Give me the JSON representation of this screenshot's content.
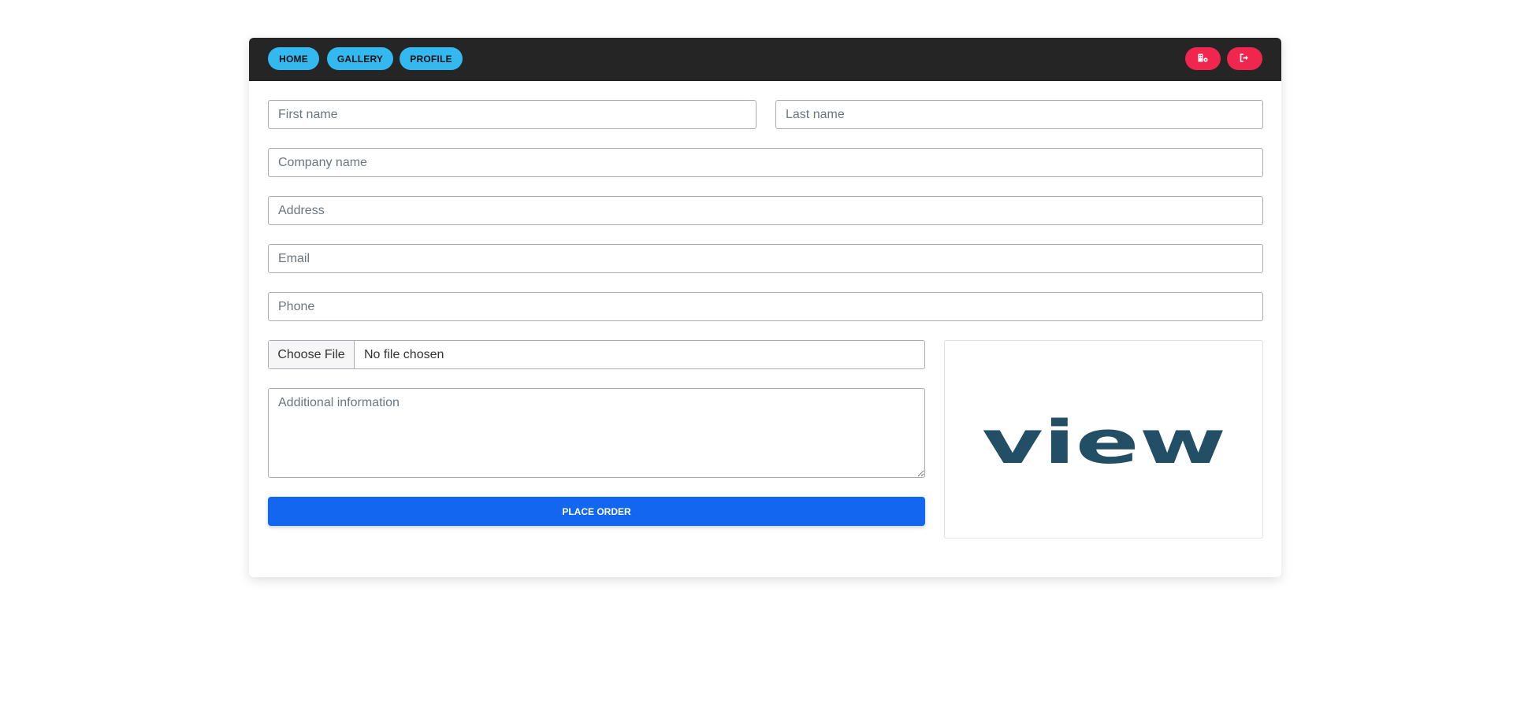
{
  "nav": {
    "home_label": "HOME",
    "gallery_label": "GALLERY",
    "profile_label": "PROFILE",
    "icons": [
      "building-icon",
      "sign-out-icon"
    ]
  },
  "form": {
    "first_name": {
      "placeholder": "First name",
      "value": ""
    },
    "last_name": {
      "placeholder": "Last name",
      "value": ""
    },
    "company_name": {
      "placeholder": "Company name",
      "value": ""
    },
    "address": {
      "placeholder": "Address",
      "value": ""
    },
    "email": {
      "placeholder": "Email",
      "value": ""
    },
    "phone": {
      "placeholder": "Phone",
      "value": ""
    },
    "file": {
      "button_label": "Choose File",
      "status": "No file chosen"
    },
    "additional_info": {
      "placeholder": "Additional information",
      "value": ""
    },
    "submit_label": "PLACE ORDER"
  },
  "preview": {
    "logo_text": "view"
  },
  "colors": {
    "navbar": "#252525",
    "nav_pill": "#33b9ef",
    "icon_pill": "#f0264e",
    "submit": "#1366f0",
    "logo": "#224e66"
  }
}
